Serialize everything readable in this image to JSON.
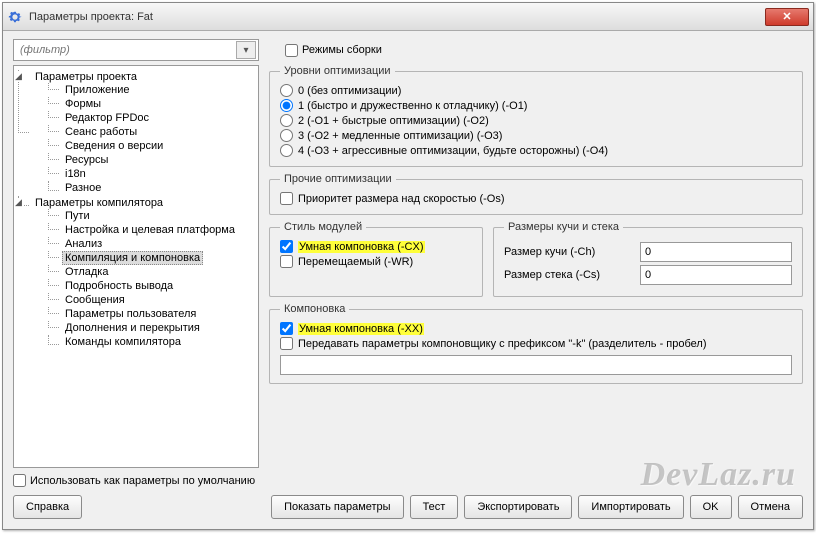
{
  "window": {
    "title": "Параметры проекта: Fat"
  },
  "filter": {
    "placeholder": "(фильтр)"
  },
  "buildmodes": {
    "label": "Режимы сборки"
  },
  "tree": {
    "root1": {
      "label": "Параметры проекта"
    },
    "root1_children": {
      "app": "Приложение",
      "forms": "Формы",
      "fpdoc": "Редактор FPDoc",
      "session": "Сеанс работы",
      "version": "Сведения о версии",
      "resources": "Ресурсы",
      "i18n": "i18n",
      "misc": "Разное"
    },
    "root2": {
      "label": "Параметры компилятора"
    },
    "root2_children": {
      "paths": "Пути",
      "target": "Настройка и целевая платформа",
      "analysis": "Анализ",
      "compile": "Компиляция и компоновка",
      "debug": "Отладка",
      "verbose": "Подробность вывода",
      "messages": "Сообщения",
      "userparams": "Параметры пользователя",
      "override": "Дополнения и перекрытия",
      "cmds": "Команды компилятора"
    }
  },
  "optlevels": {
    "legend": "Уровни оптимизации",
    "o0": "0 (без оптимизации)",
    "o1": "1 (быстро и дружественно к отладчику) (-O1)",
    "o2": "2 (-O1 + быстрые оптимизации) (-O2)",
    "o3": "3 (-O2 + медленные оптимизации) (-O3)",
    "o4": "4 (-O3 + агрессивные оптимизации, будьте осторожны) (-O4)"
  },
  "otheropt": {
    "legend": "Прочие оптимизации",
    "os": "Приоритет размера над скоростью (-Os)"
  },
  "unitstyle": {
    "legend": "Стиль модулей",
    "cx": "Умная компоновка (-CX)",
    "wr": "Перемещаемый (-WR)"
  },
  "heap": {
    "legend": "Размеры кучи и стека",
    "ch_label": "Размер кучи (-Ch)",
    "ch_value": "0",
    "cs_label": "Размер стека (-Cs)",
    "cs_value": "0"
  },
  "linking": {
    "legend": "Компоновка",
    "xx": "Умная компоновка (-XX)",
    "passopt": "Передавать параметры компоновщику с префиксом \"-k\" (разделитель - пробел)",
    "passopt_value": ""
  },
  "defaults": {
    "label": "Использовать как параметры по умолчанию"
  },
  "buttons": {
    "help": "Справка",
    "showparams": "Показать параметры",
    "test": "Тест",
    "export": "Экспортировать",
    "import": "Импортировать",
    "ok": "OK",
    "cancel": "Отмена"
  },
  "watermark": "DevLaz.ru"
}
